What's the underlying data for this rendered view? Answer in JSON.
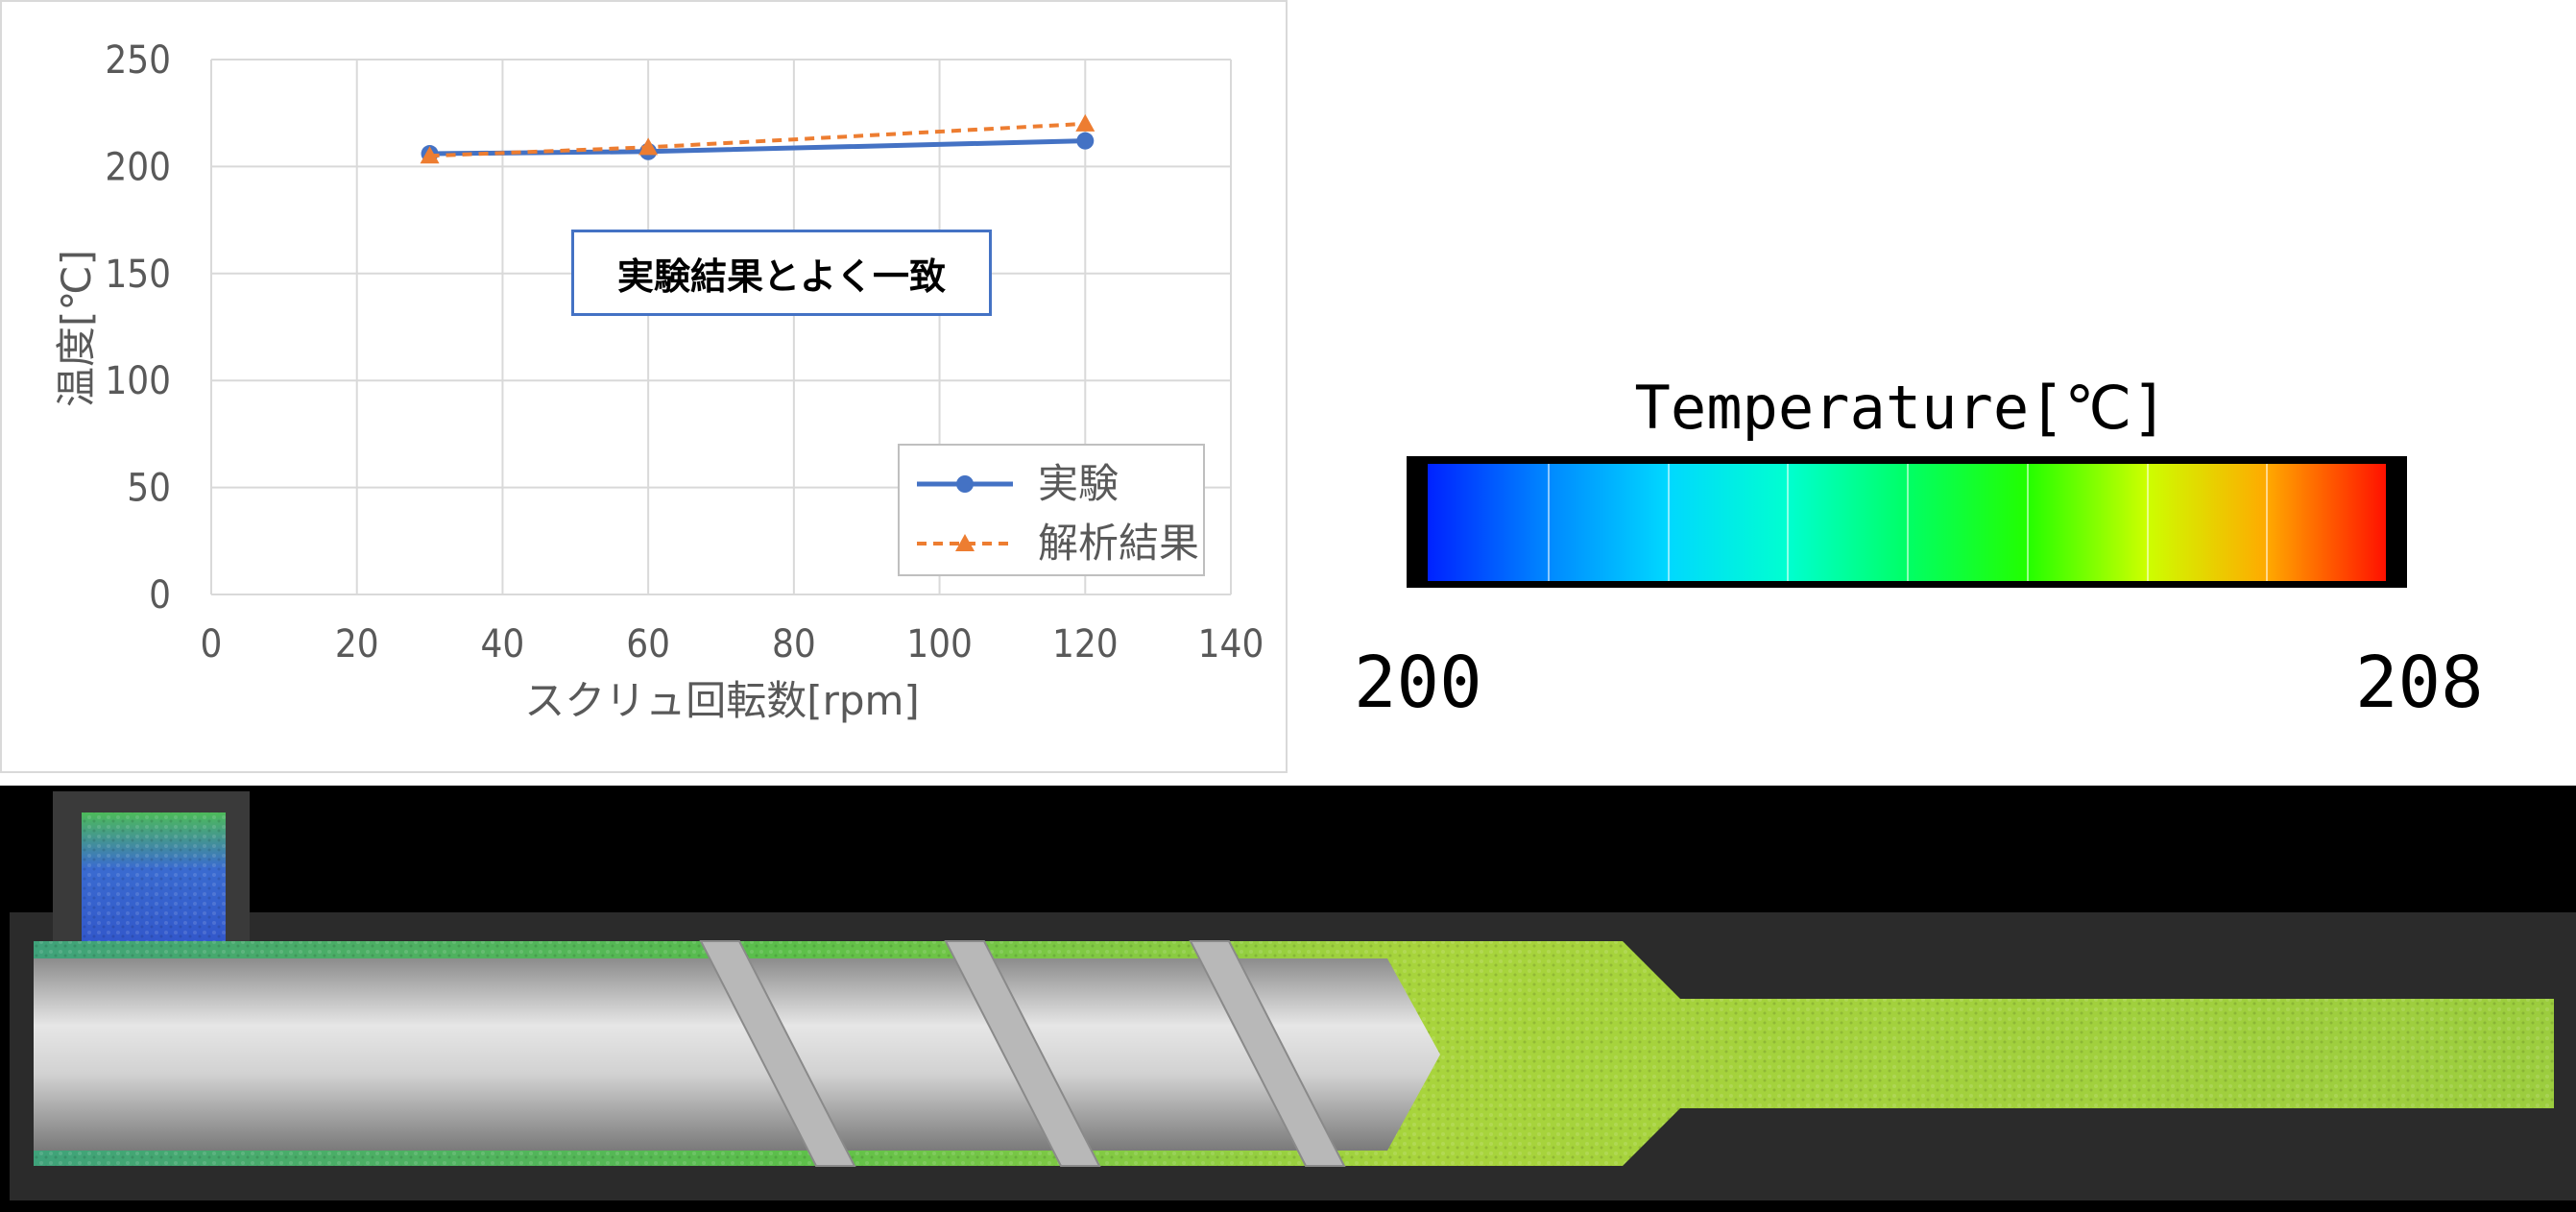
{
  "chart_data": {
    "type": "line",
    "x": [
      30,
      60,
      120
    ],
    "series": [
      {
        "name": "実験",
        "values": [
          206,
          207,
          212
        ],
        "color": "#4472c4",
        "marker": "circle",
        "style": "solid"
      },
      {
        "name": "解析結果",
        "values": [
          205,
          209,
          220
        ],
        "color": "#ed7d31",
        "marker": "triangle",
        "style": "dashed"
      }
    ],
    "xlabel": "スクリュ回転数[rpm]",
    "ylabel": "温度[℃]",
    "xlim": [
      0,
      140
    ],
    "ylim": [
      0,
      250
    ],
    "xticks": [
      "0",
      "20",
      "40",
      "60",
      "80",
      "100",
      "120",
      "140"
    ],
    "yticks": [
      "0",
      "50",
      "100",
      "150",
      "200",
      "250"
    ],
    "grid": true,
    "legend_position": "bottom-right",
    "annotation": "実験結果とよく一致"
  },
  "colorbar": {
    "title": "Temperature[℃]",
    "min_label": "200",
    "max_label": "208",
    "segments": 8
  }
}
